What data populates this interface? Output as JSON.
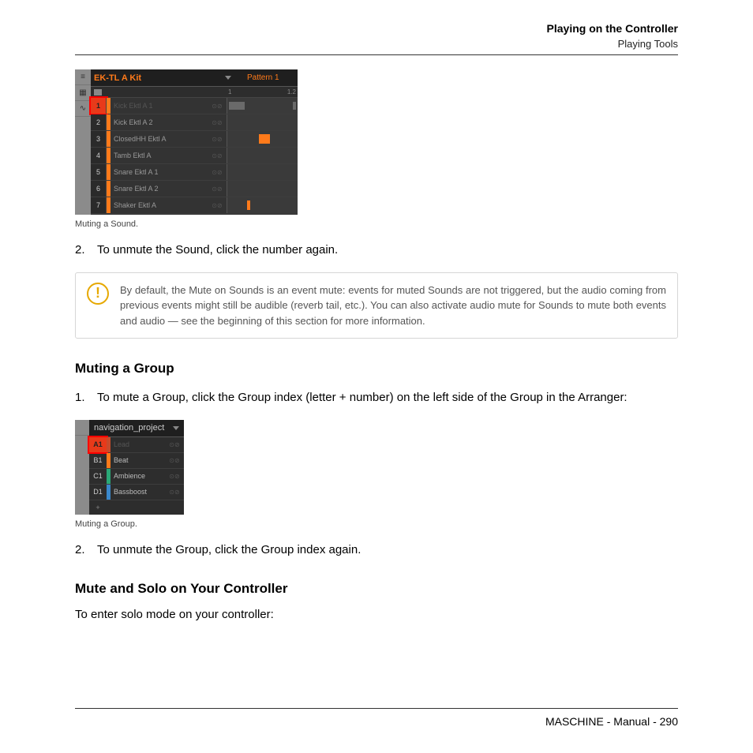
{
  "header": {
    "title": "Playing on the Controller",
    "subtitle": "Playing Tools"
  },
  "screenshot1": {
    "kitName": "EK-TL A Kit",
    "patternLabel": "Pattern 1",
    "ruler": {
      "start": "1",
      "end": "1.2"
    },
    "rows": [
      {
        "num": "1",
        "label": "Kick Ektl A 1",
        "selected": true,
        "muted": true
      },
      {
        "num": "2",
        "label": "Kick Ektl A 2"
      },
      {
        "num": "3",
        "label": "ClosedHH Ektl A"
      },
      {
        "num": "4",
        "label": "Tamb Ektl A"
      },
      {
        "num": "5",
        "label": "Snare Ektl A 1"
      },
      {
        "num": "6",
        "label": "Snare Ektl A 2"
      },
      {
        "num": "7",
        "label": "Shaker Ektl A"
      }
    ],
    "caption": "Muting a Sound."
  },
  "steps1": {
    "n2": "2.",
    "t2": "To unmute the Sound, click the number again."
  },
  "callout": {
    "text": "By default, the Mute on Sounds is an event mute: events for muted Sounds are not triggered, but the audio coming from previous events might still be audible (reverb tail, etc.). You can also activate audio mute for Sounds to mute both events and audio — see the beginning of this section for more information."
  },
  "section2": {
    "title": "Muting a Group"
  },
  "steps2a": {
    "n1": "1.",
    "t1": "To mute a Group, click the Group index (letter + number) on the left side of the Group in the Arranger:"
  },
  "screenshot2": {
    "project": "navigation_project",
    "rows": [
      {
        "idx": "A1",
        "label": "Lead",
        "selected": true,
        "muted": true,
        "color": "#c94a2a"
      },
      {
        "idx": "B1",
        "label": "Beat",
        "color": "#ff7a1a"
      },
      {
        "idx": "C1",
        "label": "Ambience",
        "color": "#2aa876"
      },
      {
        "idx": "D1",
        "label": "Bassboost",
        "color": "#3a88cc"
      }
    ],
    "plus": "+",
    "caption": "Muting a Group."
  },
  "steps2b": {
    "n2": "2.",
    "t2": "To unmute the Group, click the Group index again."
  },
  "section3": {
    "title": "Mute and Solo on Your Controller",
    "text": "To enter solo mode on your controller:"
  },
  "footer": {
    "text": "MASCHINE - Manual - 290"
  }
}
